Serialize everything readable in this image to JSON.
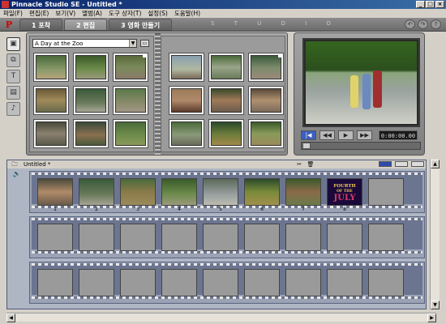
{
  "window": {
    "title": "Pinnacle Studio SE - Untitled *",
    "buttons": [
      "_",
      "□",
      "×"
    ]
  },
  "menu": [
    "파일(F)",
    "편집(E)",
    "보기(V)",
    "앨범(A)",
    "도구 상자(T)",
    "설정(S)",
    "도움말(H)"
  ],
  "studio_bar": {
    "tabs": [
      {
        "label": "1 포착",
        "active": false
      },
      {
        "label": "2 편집",
        "active": true
      },
      {
        "label": "3 영화 만들기",
        "active": false
      }
    ],
    "brand": "S T U D I O",
    "icons": [
      "undo-icon",
      "redo-icon",
      "help-icon"
    ]
  },
  "album": {
    "selected": "A Day at the Zoo"
  },
  "player": {
    "timecode": "0:00:00.00",
    "controls": [
      "|◀",
      "◀◀",
      "▶",
      "▶▶"
    ]
  },
  "movie": {
    "title": "Untitled *",
    "clip_numbers": [
      "1",
      "2",
      "3",
      "4",
      "5",
      "6",
      "7",
      "8"
    ],
    "title_clip": {
      "line1": "FOURTH",
      "line2": "OF THE",
      "line3": "JULY"
    }
  },
  "colors": {
    "titlebar_start": "#0a246a",
    "titlebar_end": "#3a6ea5",
    "timeline_bg": "#aeb6c4",
    "active_view": "#2f4da8"
  }
}
